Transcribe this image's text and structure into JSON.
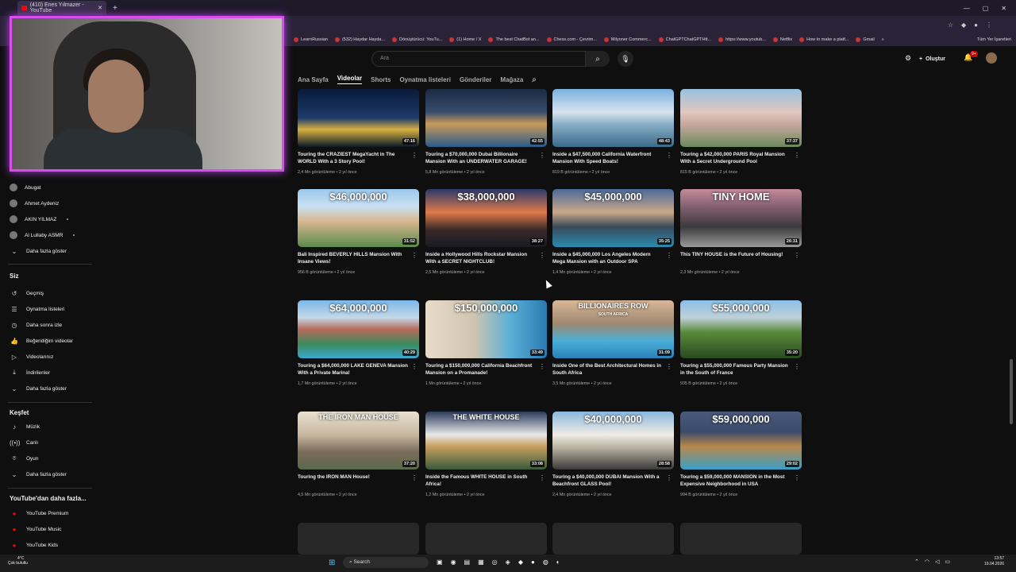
{
  "browser": {
    "tab_title": "(410) Enes Yılmazer - YouTube",
    "new_tab": "+",
    "bookmarks": [
      "LearnRussian",
      "(532) Haydar Hayda...",
      "Dönüştürücü: YouTu...",
      "(1) Home / X",
      "The best ChatBot an...",
      "Chess.com - Çevrim...",
      "Milyoner Commerc...",
      "ChatGPTChatGPTHtt...",
      "https://www.youtub...",
      "Netflix",
      "How to make a platf...",
      "Gmail"
    ],
    "bookmarks_more": "»",
    "all_bookmarks": "Tüm Yer İşaretleri"
  },
  "youtube": {
    "search_placeholder": "Ara",
    "create_label": "Oluştur",
    "notif_count": "9+"
  },
  "channel_tabs": [
    "Ana Sayfa",
    "Videolar",
    "Shorts",
    "Oynatma listeleri",
    "Gönderiler",
    "Mağaza"
  ],
  "active_tab": "Videolar",
  "sidebar": {
    "subscriptions": [
      "Abugat",
      "Ahmet Aydeniz",
      "AKIN YILMAZ",
      "Al Lullaby ASMR"
    ],
    "show_more_1": "Daha fazla göster",
    "you_header": "Siz",
    "you_items": [
      "Geçmiş",
      "Oynatma listeleri",
      "Daha sonra izle",
      "Beğendiğim videolar",
      "Videolarınız",
      "İndirilenler"
    ],
    "show_more_2": "Daha fazla göster",
    "explore_header": "Keşfet",
    "explore_items": [
      "Müzik",
      "Canlı",
      "Oyun"
    ],
    "show_more_3": "Daha fazla göster",
    "more_header": "YouTube'dan daha fazla...",
    "more_items": [
      "YouTube Premium",
      "YouTube Music",
      "YouTube Kids"
    ]
  },
  "videos": [
    {
      "title": "Touring the CRAZIEST MegaYacht in The WORLD With a 3 Story Pool!",
      "meta": "2,4 Mn görüntüleme • 2 yıl önce",
      "duration": "47:16",
      "price": "",
      "theme": "yacht"
    },
    {
      "title": "Touring a $70,000,000 Dubai Billionaire Mansion With an UNDERWATER GARAGE!",
      "meta": "5,8 Mn görüntüleme • 2 yıl önce",
      "duration": "42:55",
      "price": "",
      "theme": "night"
    },
    {
      "title": "Inside a $47,500,000 California Waterfront Mansion With Speed Boats!",
      "meta": "819 B görüntüleme • 2 yıl önce",
      "duration": "48:43",
      "price": "",
      "theme": "water"
    },
    {
      "title": "Touring a $42,000,000 PARIS Royal Mansion With a Secret Underground Pool",
      "meta": "815 B görüntüleme • 2 yıl önce",
      "duration": "37:37",
      "price": "",
      "theme": "paris"
    },
    {
      "title": "Bali Inspired BEVERLY HILLS Mansion With Insane Views!",
      "meta": "956 B görüntüleme • 2 yıl önce",
      "duration": "31:52",
      "price": "$46,000,000",
      "theme": "hills"
    },
    {
      "title": "Inside a Hollywood Hills Rockstar Mansion With a SECRET NIGHTCLUB!",
      "meta": "2,5 Mn görüntüleme • 2 yıl önce",
      "duration": "38:27",
      "price": "$38,000,000",
      "theme": "sunset"
    },
    {
      "title": "Inside a $45,000,000 Los Angeles Modern Mega Mansion with an Outdoor SPA",
      "meta": "1,4 Mn görüntüleme • 2 yıl önce",
      "duration": "35:25",
      "price": "$45,000,000",
      "theme": "dusk"
    },
    {
      "title": "This TINY HOUSE is the Future of Housing!",
      "meta": "2,3 Mn görüntüleme • 2 yıl önce",
      "duration": "26:31",
      "price": "TINY HOME",
      "theme": "tiny"
    },
    {
      "title": "Touring a $64,000,000 LAKE GENEVA Mansion With a Private Marina!",
      "meta": "1,7 Mn görüntüleme • 2 yıl önce",
      "duration": "40:29",
      "price": "$64,000,000",
      "theme": "lake"
    },
    {
      "title": "Touring a $150,000,000 California Beachfront Mansion on a Promanade!",
      "meta": "1 Mn görüntüleme • 2 yıl önce",
      "duration": "33:49",
      "price": "$150,000,000",
      "theme": "beach"
    },
    {
      "title": "Inside One of the Best Architectural Homes in South Africa",
      "meta": "3,5 Mn görüntüleme • 2 yıl önce",
      "duration": "31:09",
      "price": "BILLIONAIRES ROW",
      "subprice": "SOUTH AFRICA",
      "theme": "pool"
    },
    {
      "title": "Touring a $55,000,000 Famous Party Mansion in the South of France",
      "meta": "935 B görüntüleme • 2 yıl önce",
      "duration": "35:20",
      "price": "$55,000,000",
      "theme": "green"
    },
    {
      "title": "Touring the IRON MAN House!",
      "meta": "4,5 Mn görüntüleme • 2 yıl önce",
      "duration": "37:20",
      "price": "THE IRON MAN HOUSE",
      "theme": "iron"
    },
    {
      "title": "Inside the Famous WHITE HOUSE in South Africa!",
      "meta": "1,2 Mn görüntüleme • 2 yıl önce",
      "duration": "33:08",
      "price": "THE WHITE HOUSE",
      "theme": "white"
    },
    {
      "title": "Touring a $40,000,000 DUBAI Mansion With a Beachfront GLASS Pool!",
      "meta": "2,4 Mn görüntüleme • 2 yıl önce",
      "duration": "28:58",
      "price": "$40,000,000",
      "theme": "dubai"
    },
    {
      "title": "Touring a $59,000,000 MANSION in the Most Expensive Neighborhood in USA",
      "meta": "994 B görüntüleme • 2 yıl önce",
      "duration": "29:02",
      "price": "$59,000,000",
      "theme": "usa"
    }
  ],
  "taskbar": {
    "weather_temp": "4°C",
    "weather_desc": "Çok bulutlu",
    "search": "Search",
    "time": "13:57",
    "date": "19.04.2026"
  }
}
